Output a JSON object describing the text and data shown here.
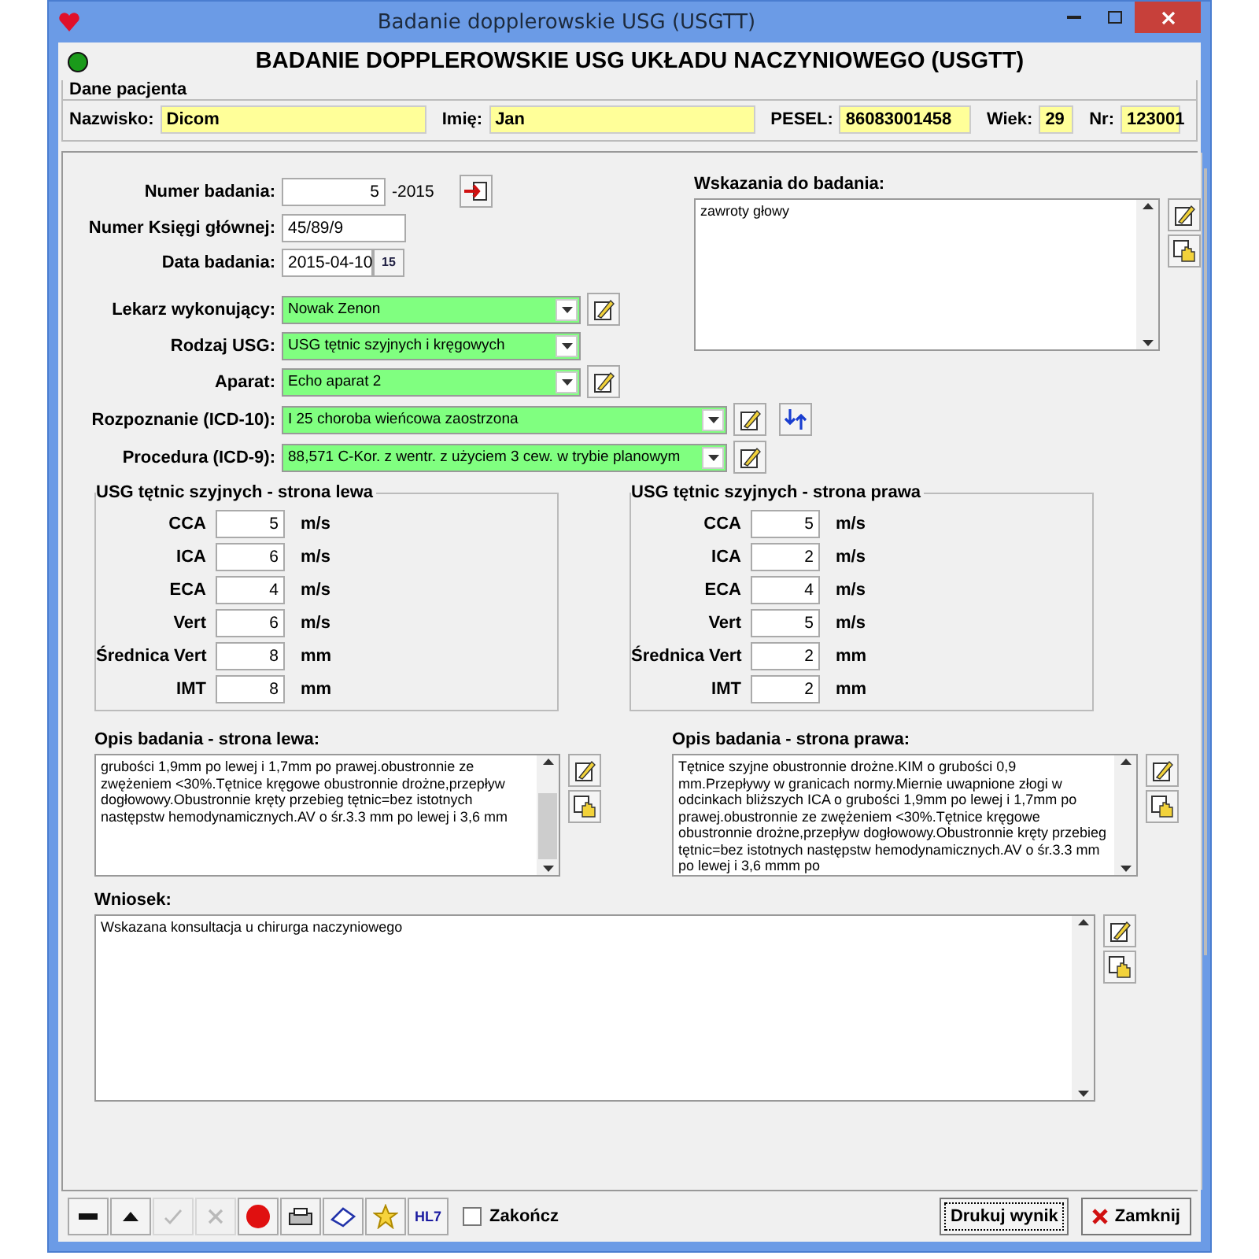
{
  "window": {
    "title": "Badanie dopplerowskie USG (USGTT)"
  },
  "header": {
    "title": "BADANIE DOPPLEROWSKIE USG UKŁADU NACZYNIOWEGO (USGTT)"
  },
  "patient": {
    "group": "Dane pacjenta",
    "fields": [
      {
        "label": "Nazwisko:",
        "value": "Dicom"
      },
      {
        "label": "Imię:",
        "value": "Jan"
      },
      {
        "label": "PESEL:",
        "value": "86083001458"
      },
      {
        "label": "Wiek:",
        "value": "29"
      },
      {
        "label": "Nr:",
        "value": "123001"
      }
    ]
  },
  "exam": {
    "number": {
      "label": "Numer badania:",
      "value": "5",
      "suffix": "-2015"
    },
    "book": {
      "label": "Numer Księgi głównej:",
      "value": "45/89/9"
    },
    "date": {
      "label": "Data badania:",
      "value": "2015-04-10",
      "calendar": "15"
    },
    "selects": [
      {
        "label": "Lekarz wykonujący:",
        "value": "Nowak  Zenon",
        "wide": false,
        "edit": true,
        "swap": false
      },
      {
        "label": "Rodzaj USG:",
        "value": "USG tętnic szyjnych i kręgowych",
        "wide": false,
        "edit": false,
        "swap": false
      },
      {
        "label": "Aparat:",
        "value": "Echo aparat 2",
        "wide": false,
        "edit": true,
        "swap": false
      },
      {
        "label": "Rozpoznanie (ICD-10):",
        "value": "I  25  choroba wieńcowa zaostrzona",
        "wide": true,
        "edit": true,
        "swap": true
      },
      {
        "label": "Procedura (ICD-9):",
        "value": "88,571  C-Kor. z wentr. z użyciem 3 cew. w trybie planowym",
        "wide": true,
        "edit": true,
        "swap": false
      }
    ]
  },
  "indications": {
    "label": "Wskazania do badania:",
    "text": "zawroty głowy"
  },
  "panels": [
    {
      "title": "USG tętnic szyjnych - strona lewa",
      "rows": [
        {
          "label": "CCA",
          "value": "5",
          "unit": "m/s"
        },
        {
          "label": "ICA",
          "value": "6",
          "unit": "m/s"
        },
        {
          "label": "ECA",
          "value": "4",
          "unit": "m/s"
        },
        {
          "label": "Vert",
          "value": "6",
          "unit": "m/s"
        },
        {
          "label": "Średnica Vert",
          "value": "8",
          "unit": "mm"
        },
        {
          "label": "IMT",
          "value": "8",
          "unit": "mm"
        }
      ]
    },
    {
      "title": "USG tętnic szyjnych - strona prawa",
      "rows": [
        {
          "label": "CCA",
          "value": "5",
          "unit": "m/s"
        },
        {
          "label": "ICA",
          "value": "2",
          "unit": "m/s"
        },
        {
          "label": "ECA",
          "value": "4",
          "unit": "m/s"
        },
        {
          "label": "Vert",
          "value": "5",
          "unit": "m/s"
        },
        {
          "label": "Średnica Vert",
          "value": "2",
          "unit": "mm"
        },
        {
          "label": "IMT",
          "value": "2",
          "unit": "mm"
        }
      ]
    }
  ],
  "descriptions": [
    {
      "label": "Opis badania - strona lewa:",
      "text": "grubości 1,9mm po lewej i 1,7mm po prawej.obustronnie ze zwężeniem <30%.Tętnice kręgowe obustronnie drożne,przepływ dogłowowy.Obustronnie kręty przebieg tętnic=bez istotnych następstw hemodynamicznych.AV o śr.3.3 mm po lewej i 3,6 mm",
      "scrolled": true
    },
    {
      "label": "Opis badania - strona prawa:",
      "text": "Tętnice szyjne obustronnie drożne.KIM o grubości 0,9 mm.Przepływy w granicach normy.Miernie uwapnione złogi w odcinkach bliższych ICA o grubości 1,9mm po lewej i 1,7mm po prawej.obustronnie ze zwężeniem <30%.Tętnice kręgowe obustronnie drożne,przepływ dogłowowy.Obustronnie kręty przebieg tętnic=bez istotnych następstw hemodynamicznych.AV o śr.3.3 mm po lewej i 3,6 mmm po",
      "scrolled": false
    }
  ],
  "conclusion": {
    "label": "Wniosek:",
    "text": "Wskazana konsultacja u chirurga naczyniowego"
  },
  "toolbar": {
    "buttons": [
      {
        "kind": "minus",
        "disabled": false
      },
      {
        "kind": "up",
        "disabled": false
      },
      {
        "kind": "check",
        "disabled": true
      },
      {
        "kind": "cross",
        "disabled": true
      },
      {
        "kind": "record",
        "disabled": false
      },
      {
        "kind": "printer",
        "disabled": false
      },
      {
        "kind": "eraser",
        "disabled": false
      },
      {
        "kind": "star",
        "disabled": false
      },
      {
        "kind": "text",
        "label": "HL7",
        "disabled": false
      }
    ],
    "checkbox": {
      "label": "Zakończ",
      "checked": false
    },
    "print": "Drukuj wynik",
    "close": "Zamknij"
  }
}
